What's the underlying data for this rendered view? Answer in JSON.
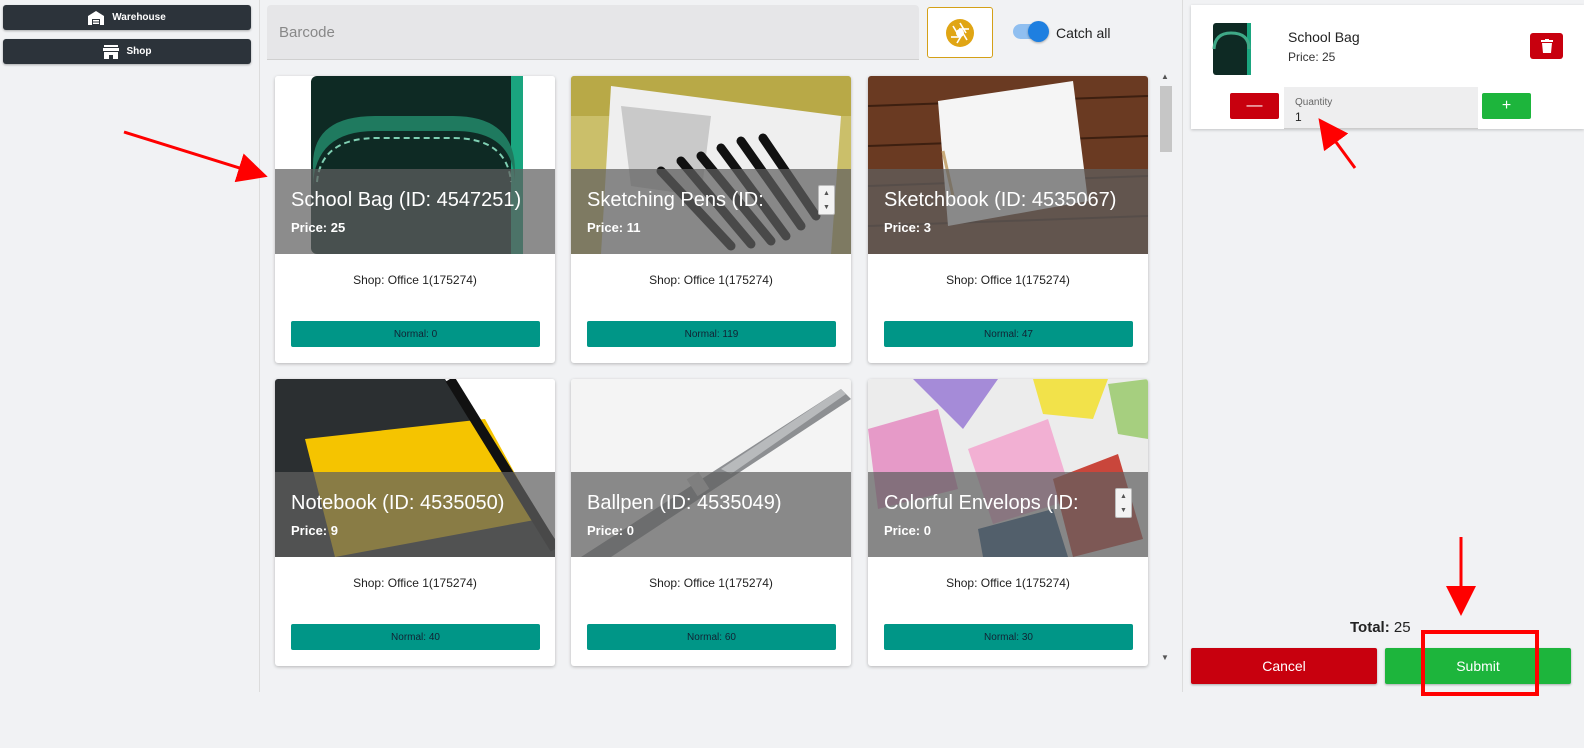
{
  "sidebar": {
    "items": [
      {
        "label": "Warehouse",
        "icon": "warehouse-icon"
      },
      {
        "label": "Shop",
        "icon": "store-icon"
      }
    ]
  },
  "topbar": {
    "barcode_placeholder": "Barcode",
    "camera_icon": "camera-shutter-icon",
    "catch_all_label": "Catch all",
    "catch_all_on": true
  },
  "products": [
    {
      "title": "School Bag (ID: 4547251)",
      "price": "Price: 25",
      "shop": "Shop: Office 1(175274)",
      "stock": "Normal: 0"
    },
    {
      "title": "Sketching Pens (ID:",
      "price": "Price: 11",
      "shop": "Shop: Office 1(175274)",
      "stock": "Normal: 119"
    },
    {
      "title": "Sketchbook (ID: 4535067)",
      "price": "Price: 3",
      "shop": "Shop: Office 1(175274)",
      "stock": "Normal: 47"
    },
    {
      "title": "Notebook (ID: 4535050)",
      "price": "Price: 9",
      "shop": "Shop: Office 1(175274)",
      "stock": "Normal: 40"
    },
    {
      "title": "Ballpen (ID: 4535049)",
      "price": "Price: 0",
      "shop": "Shop: Office 1(175274)",
      "stock": "Normal: 60"
    },
    {
      "title": "Colorful Envelops (ID:",
      "price": "Price: 0",
      "shop": "Shop: Office 1(175274)",
      "stock": "Normal: 30"
    }
  ],
  "cart": {
    "item_name": "School Bag",
    "item_price": "Price: 25",
    "quantity_label": "Quantity",
    "quantity_value": "1",
    "minus": "—",
    "plus": "+",
    "total_label": "Total:",
    "total_value": "25",
    "cancel_label": "Cancel",
    "submit_label": "Submit"
  },
  "colors": {
    "stock_bar": "#009687",
    "danger": "#c8000e",
    "success": "#1db53c",
    "sidebar_btn": "#2c333a",
    "accent_toggle": "#1e7fe0",
    "camera_border": "#d4a017"
  }
}
